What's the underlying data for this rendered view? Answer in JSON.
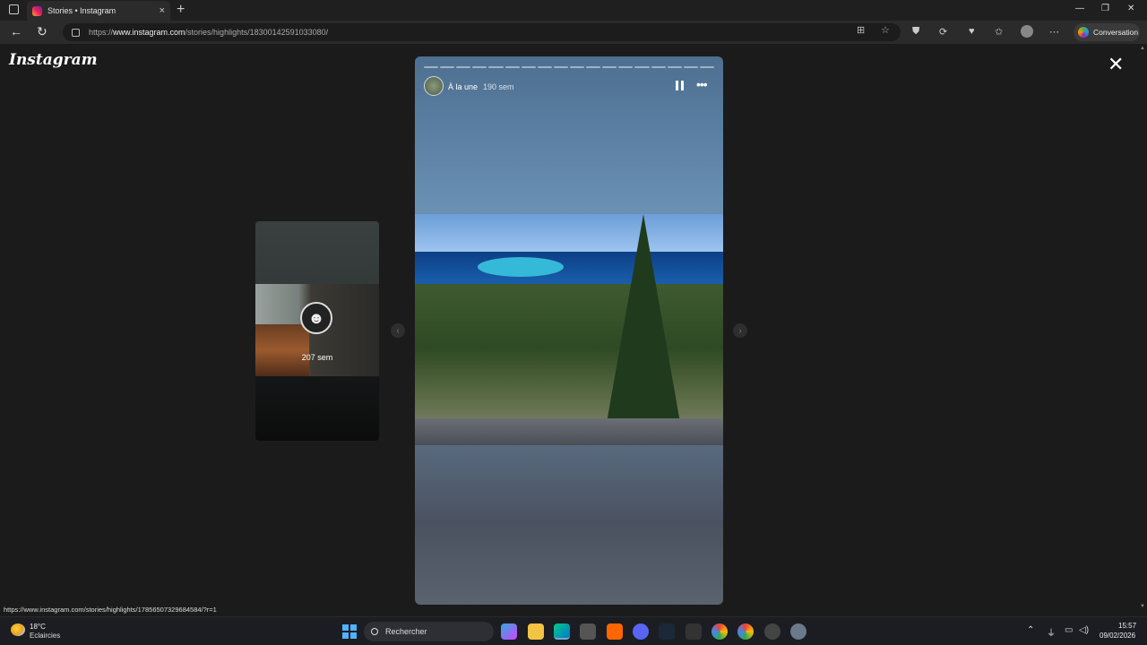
{
  "browser": {
    "tab_title": "Stories • Instagram",
    "tab_close": "×",
    "new_tab": "+",
    "url_prefix": "https://",
    "url_host": "www.instagram.com",
    "url_path": "/stories/highlights/18300142591033080/",
    "conversation_label": "Conversation",
    "window_controls": [
      "—",
      "❐",
      "✕"
    ]
  },
  "instagram": {
    "logo": "Instagram",
    "close": "✕"
  },
  "prev_story": {
    "time_label": "207 sem"
  },
  "story": {
    "segments": 18,
    "account_name": "À la une",
    "age": "190 sem"
  },
  "status_bar_url": "https://www.instagram.com/stories/highlights/17856507329684584/?r=1",
  "taskbar": {
    "weather_temp": "18°C",
    "weather_desc": "Eclaircies",
    "search_placeholder": "Rechercher",
    "clock_time": "15:57",
    "clock_date": "09/02/2026"
  }
}
